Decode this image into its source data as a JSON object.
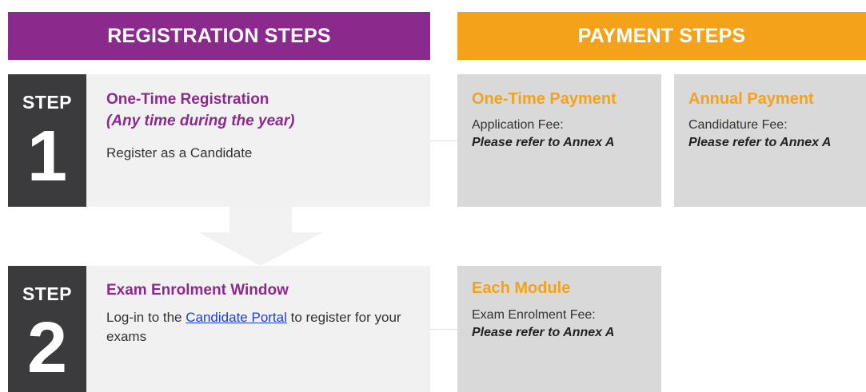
{
  "banners": {
    "registration": "REGISTRATION STEPS",
    "payment": "PAYMENT STEPS"
  },
  "steps": [
    {
      "tab_word": "STEP",
      "tab_number": "1",
      "title": "One-Time Registration",
      "subtitle": "(Any time during the year)",
      "description": "Register as a Candidate"
    },
    {
      "tab_word": "STEP",
      "tab_number": "2",
      "title": "Exam Enrolment Window",
      "desc_before": "Log-in to the ",
      "link_text": "Candidate Portal",
      "desc_after": " to register for your exams"
    }
  ],
  "payments": [
    {
      "title": "One-Time Payment",
      "label": "Application Fee:",
      "value": "Please refer to Annex A"
    },
    {
      "title": "Annual Payment",
      "label": "Candidature Fee:",
      "value": "Please refer to Annex A"
    },
    {
      "title": "Each Module",
      "label": "Exam Enrolment Fee:",
      "value": "Please refer to Annex A"
    }
  ],
  "colors": {
    "registration_accent": "#8a2a8c",
    "payment_accent": "#f5a21b",
    "step_tab": "#3b3b3d",
    "link": "#1f3fd6"
  },
  "icons": {
    "down_arrow": "arrow-down-icon"
  }
}
